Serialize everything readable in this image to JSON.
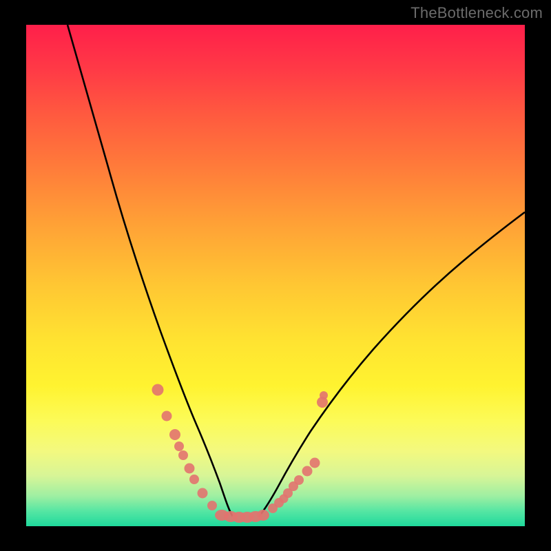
{
  "watermark": "TheBottleneck.com",
  "colors": {
    "frame": "#000000",
    "watermark": "#6b6b6b",
    "curve": "#000000",
    "dot": "#e2736f",
    "gradient_top": "#ff1f4a",
    "gradient_bottom": "#1fd99c"
  },
  "chart_data": {
    "type": "line",
    "title": "",
    "xlabel": "",
    "ylabel": "",
    "xlim": [
      0,
      100
    ],
    "ylim": [
      0,
      100
    ],
    "series": [
      {
        "name": "left-curve",
        "x": [
          8.3,
          10,
          12.5,
          15,
          17.5,
          20,
          22.5,
          25,
          27.5,
          30,
          31.5,
          33,
          34.5,
          36,
          37.5,
          39,
          40.5
        ],
        "values": [
          100,
          92,
          80,
          68,
          57,
          47,
          38,
          30,
          23,
          17,
          13.5,
          10.5,
          8,
          6,
          4.3,
          3,
          2.2
        ]
      },
      {
        "name": "right-curve",
        "x": [
          46,
          48,
          50,
          52.5,
          55,
          58,
          61,
          65,
          70,
          75,
          80,
          85,
          90,
          95,
          100
        ],
        "values": [
          2.2,
          3,
          4.1,
          5.8,
          7.8,
          10.5,
          14,
          18.5,
          24.5,
          30.5,
          36.5,
          42.5,
          48,
          53.5,
          59
        ]
      },
      {
        "name": "bottom-flat",
        "x": [
          40.5,
          42,
          43.5,
          45,
          46
        ],
        "values": [
          2.2,
          2.1,
          2.1,
          2.1,
          2.2
        ]
      }
    ],
    "markers": [
      {
        "name": "left-dots",
        "x": [
          26.3,
          28.2,
          29.8,
          30.5,
          31.3,
          32.6,
          33.7,
          35.3,
          37.3
        ],
        "y": [
          27,
          21.5,
          18,
          16,
          14,
          11.3,
          9.2,
          6.6,
          4.1
        ]
      },
      {
        "name": "right-dots",
        "x": [
          49.5,
          50.7,
          51.7,
          52.5,
          53.5,
          54.7,
          56.3,
          57.8,
          59.3
        ],
        "y": [
          3.7,
          4.6,
          5.5,
          6.3,
          7.3,
          8.6,
          10.3,
          12,
          24.5
        ]
      },
      {
        "name": "bottom-blob",
        "x": [
          39,
          40.3,
          41.6,
          42.9,
          44.2,
          45.5,
          46.8
        ],
        "y": [
          2.4,
          2.2,
          2.1,
          2.1,
          2.1,
          2.2,
          2.4
        ]
      }
    ]
  }
}
